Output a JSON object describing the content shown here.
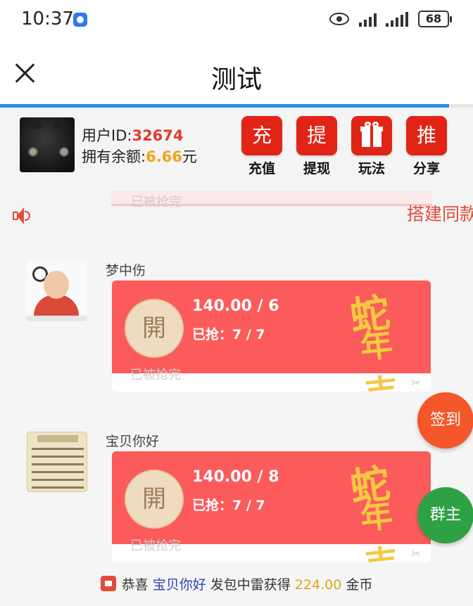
{
  "status_bar": {
    "time": "10:37",
    "battery": "68"
  },
  "header": {
    "title": "测试"
  },
  "user": {
    "id_label": "用户ID:",
    "id_value": "32674",
    "balance_label": "拥有余额:",
    "balance_value": "6.66",
    "balance_unit": "元"
  },
  "actions": [
    {
      "icon_char": "充",
      "label": "充值"
    },
    {
      "icon_char": "提",
      "label": "提现"
    },
    {
      "icon_char": "",
      "label": "玩法"
    },
    {
      "icon_char": "推",
      "label": "分享"
    }
  ],
  "marquee": {
    "ghost_text": "已被抢完",
    "text": "搭建同款"
  },
  "messages": [
    {
      "sender": "梦中伤",
      "open_char": "開",
      "amount": "140.00 / 6",
      "grabbed": "已抢：7 / 7",
      "stamp_top": "蛇",
      "stamp_bottom": "年吉",
      "status": "已被抢完"
    },
    {
      "sender": "宝贝你好",
      "open_char": "開",
      "amount": "140.00 / 8",
      "grabbed": "已抢：7 / 7",
      "stamp_top": "蛇",
      "stamp_bottom": "年吉",
      "status": "已被抢完"
    }
  ],
  "floating": {
    "checkin": "签到",
    "owner": "群主"
  },
  "notice": {
    "prefix": "恭喜",
    "name": "宝贝你好",
    "middle": "发包中雷获得",
    "amount": "224.00",
    "suffix": "金币"
  }
}
